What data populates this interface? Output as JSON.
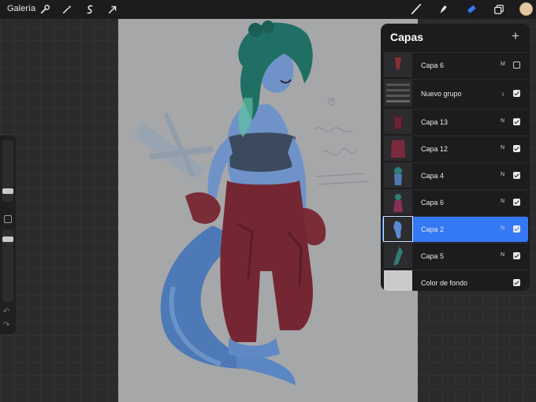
{
  "topbar": {
    "gallery_label": "Galería",
    "left_tools": [
      "wrench-icon",
      "magic-wand-icon",
      "selection-s-icon",
      "transform-arrow-icon"
    ],
    "right_tools": [
      "brush-icon",
      "smudge-icon",
      "eraser-icon",
      "layers-icon"
    ],
    "current_color": "#e4c9a0"
  },
  "sidebar": {
    "brush_size_level": 0.55,
    "opacity_level": 0.55
  },
  "canvas": {
    "background": "#a6a7a9",
    "handwriting": "Ropa de trabajo ATALANTA"
  },
  "layers_panel": {
    "title": "Capas",
    "add_label": "+",
    "layers": [
      {
        "name": "Capa 6",
        "mode": "M",
        "visible": false,
        "selected": false
      },
      {
        "name": "Nuevo grupo",
        "mode": "",
        "visible": true,
        "selected": false,
        "group": true
      },
      {
        "name": "Capa 13",
        "mode": "N",
        "visible": true,
        "selected": false
      },
      {
        "name": "Capa 12",
        "mode": "N",
        "visible": true,
        "selected": false
      },
      {
        "name": "Capa 4",
        "mode": "N",
        "visible": true,
        "selected": false
      },
      {
        "name": "Capa 6",
        "mode": "N",
        "visible": true,
        "selected": false
      },
      {
        "name": "Capa 2",
        "mode": "N",
        "visible": true,
        "selected": true
      },
      {
        "name": "Capa 5",
        "mode": "N",
        "visible": true,
        "selected": false
      },
      {
        "name": "Color de fondo",
        "mode": "",
        "visible": true,
        "selected": false
      }
    ]
  },
  "colors": {
    "selection_blue": "#3478f6",
    "panel_bg": "#1c1c1e"
  }
}
